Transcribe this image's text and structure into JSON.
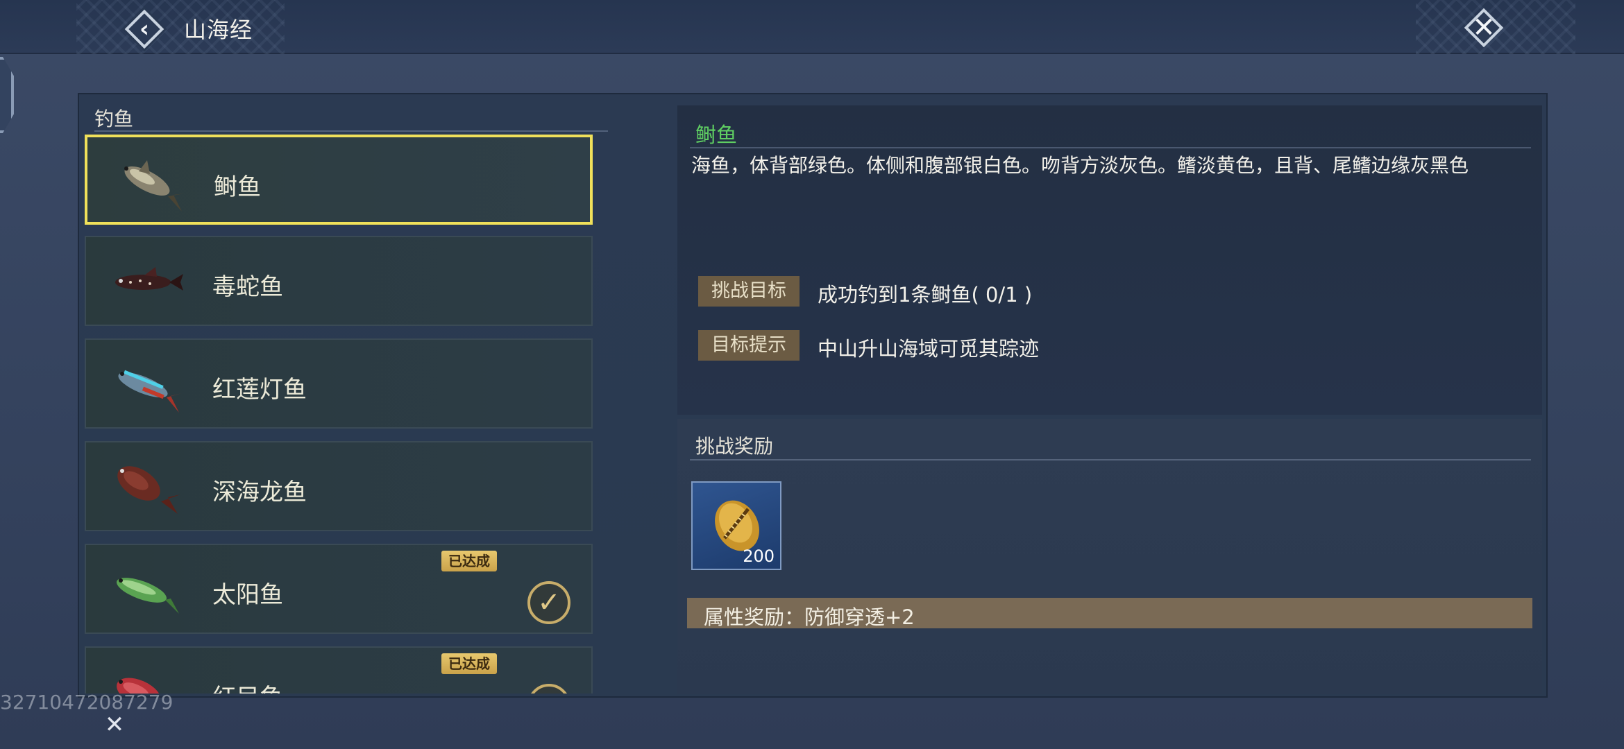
{
  "header": {
    "title": "山海经",
    "back_icon": "chevron-left-icon",
    "close_icon": "close-icon"
  },
  "fish_list": {
    "heading": "钓鱼",
    "items": [
      {
        "name": "鲥鱼",
        "selected": true,
        "completed": false,
        "icon": "fish-icon"
      },
      {
        "name": "毒蛇鱼",
        "selected": false,
        "completed": false,
        "icon": "fish-icon"
      },
      {
        "name": "红莲灯鱼",
        "selected": false,
        "completed": false,
        "icon": "fish-icon"
      },
      {
        "name": "深海龙鱼",
        "selected": false,
        "completed": false,
        "icon": "fish-icon"
      },
      {
        "name": "太阳鱼",
        "selected": false,
        "completed": true,
        "badge": "已达成",
        "icon": "fish-icon"
      },
      {
        "name": "红目鱼",
        "selected": false,
        "completed": true,
        "badge": "已达成",
        "icon": "fish-icon"
      }
    ]
  },
  "detail": {
    "name": "鲥鱼",
    "description": "海鱼，体背部绿色。体侧和腹部银白色。吻背方淡灰色。鳍淡黄色，且背、尾鳍边缘灰黑色",
    "challenge_label": "挑战目标",
    "challenge_value": "成功钓到1条鲥鱼( 0/1 )",
    "hint_label": "目标提示",
    "hint_value": "中山升山海域可觅其踪迹"
  },
  "reward": {
    "title": "挑战奖励",
    "item_count": "200",
    "item_icon": "shell-coin-icon",
    "attribute": "属性奖励：防御穿透+2"
  },
  "footer": {
    "watermark": "32710472087279",
    "corner_icon": "close-icon"
  },
  "colors": {
    "selected_border": "#f0e05a",
    "fish_name_green": "#5fce62",
    "badge_gold": "#e8c86e",
    "tag_brown": "#6b5b43"
  }
}
